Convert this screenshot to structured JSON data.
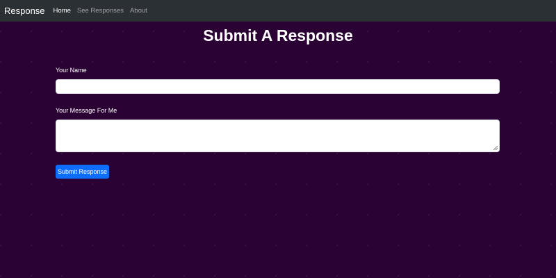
{
  "navbar": {
    "brand": "Response",
    "links": [
      {
        "label": "Home",
        "active": true
      },
      {
        "label": "See Responses",
        "active": false
      },
      {
        "label": "About",
        "active": false
      }
    ]
  },
  "main": {
    "title": "Submit A Response",
    "name_field": {
      "label": "Your Name",
      "value": "",
      "placeholder": ""
    },
    "message_field": {
      "label": "Your Message For Me",
      "value": "",
      "placeholder": ""
    },
    "submit_label": "Submit Response"
  },
  "colors": {
    "page_background": "#2a0233",
    "navbar_background": "#2b3035",
    "button_primary": "#0d6efd"
  }
}
